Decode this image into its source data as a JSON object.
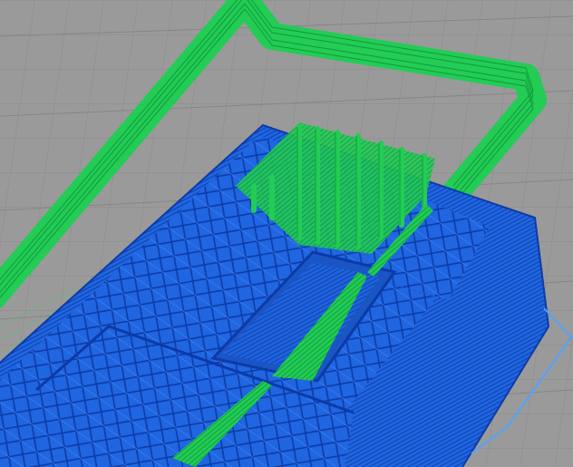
{
  "viewport": {
    "background_color": "#9a9a9a",
    "grid_color": "#8a8a8a",
    "grid_major_color": "#7c7c7c"
  },
  "toolpaths": {
    "support_color": "#22cc55",
    "support_line_color": "#0f9a3b",
    "model_color": "#1f66e0",
    "model_line_color": "#0d3aa8",
    "travel_color": "#4fa3ff"
  }
}
